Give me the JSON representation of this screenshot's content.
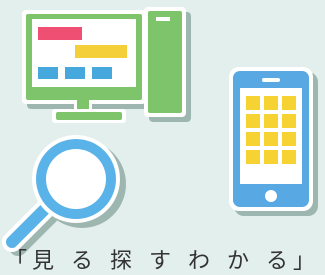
{
  "caption": "「見 る 探 す わ か る」",
  "colors": {
    "background": "#e3efec",
    "desktop_frame": "#7ec46b",
    "desktop_screen": "#ffffff",
    "bar_red": "#ef4f73",
    "bar_yellow": "#f4cf3a",
    "block_blue": "#47a8de",
    "phone_body": "#57a8e3",
    "phone_tiles": "#f6d233",
    "magnifier": "#5ab3e8",
    "outline": "#ffffff",
    "shadow": "#9db7b0"
  },
  "icons": [
    "desktop-computer-icon",
    "smartphone-icon",
    "magnifying-glass-icon"
  ]
}
